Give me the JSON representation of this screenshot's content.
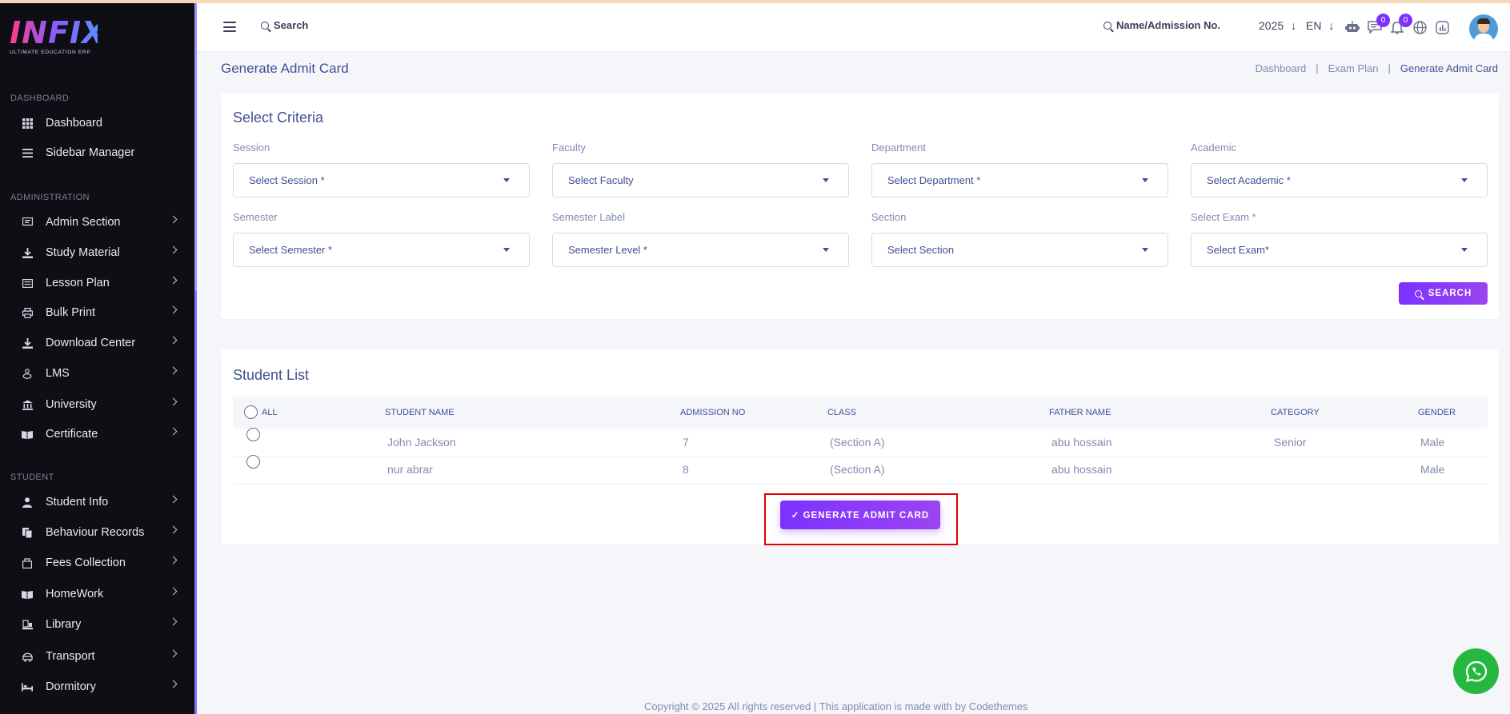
{
  "brand": {
    "logo": "INFIX",
    "tagline": "ULTIMATE EDUCATION ERP"
  },
  "sidebar": {
    "sections": [
      {
        "label": "DASHBOARD",
        "items": [
          {
            "label": "Dashboard",
            "icon": "grid-icon",
            "chevron": false
          },
          {
            "label": "Sidebar Manager",
            "icon": "menu-icon",
            "chevron": false
          }
        ]
      },
      {
        "label": "ADMINISTRATION",
        "items": [
          {
            "label": "Admin Section",
            "icon": "admin-icon",
            "chevron": true
          },
          {
            "label": "Study Material",
            "icon": "download-icon",
            "chevron": true
          },
          {
            "label": "Lesson Plan",
            "icon": "list-icon",
            "chevron": true
          },
          {
            "label": "Bulk Print",
            "icon": "printer-icon",
            "chevron": true
          },
          {
            "label": "Download Center",
            "icon": "download-icon",
            "chevron": true
          },
          {
            "label": "LMS",
            "icon": "lms-icon",
            "chevron": true
          },
          {
            "label": "University",
            "icon": "university-icon",
            "chevron": true
          },
          {
            "label": "Certificate",
            "icon": "book-icon",
            "chevron": true
          }
        ]
      },
      {
        "label": "STUDENT",
        "items": [
          {
            "label": "Student Info",
            "icon": "user-icon",
            "chevron": true
          },
          {
            "label": "Behaviour Records",
            "icon": "records-icon",
            "chevron": true
          },
          {
            "label": "Fees Collection",
            "icon": "fees-icon",
            "chevron": true
          },
          {
            "label": "HomeWork",
            "icon": "book-icon",
            "chevron": true
          },
          {
            "label": "Library",
            "icon": "library-icon",
            "chevron": true
          },
          {
            "label": "Transport",
            "icon": "transport-icon",
            "chevron": true
          },
          {
            "label": "Dormitory",
            "icon": "bed-icon",
            "chevron": true
          }
        ]
      }
    ]
  },
  "topbar": {
    "search": "Search",
    "name_search": "Name/Admission No.",
    "year": "2025",
    "lang": "EN",
    "chat_badge": "0",
    "notif_badge": "0"
  },
  "page": {
    "title": "Generate Admit Card",
    "breadcrumb": [
      "Dashboard",
      "Exam Plan",
      "Generate Admit Card"
    ]
  },
  "criteria": {
    "title": "Select Criteria",
    "fields": [
      {
        "label": "Session",
        "placeholder": "Select Session *"
      },
      {
        "label": "Faculty",
        "placeholder": "Select Faculty"
      },
      {
        "label": "Department",
        "placeholder": "Select Department *"
      },
      {
        "label": "Academic",
        "placeholder": "Select Academic *"
      },
      {
        "label": "Semester",
        "placeholder": "Select Semester *"
      },
      {
        "label": "Semester Label",
        "placeholder": "Semester Level *"
      },
      {
        "label": "Section",
        "placeholder": "Select Section"
      },
      {
        "label": "Select Exam *",
        "placeholder": "Select Exam*"
      }
    ],
    "search_button": "SEARCH"
  },
  "students": {
    "title": "Student List",
    "columns": [
      "ALL",
      "STUDENT NAME",
      "ADMISSION NO",
      "CLASS",
      "FATHER NAME",
      "CATEGORY",
      "GENDER"
    ],
    "rows": [
      {
        "name": "John Jackson",
        "admission": "7",
        "class": "(Section A)",
        "father": "abu hossain",
        "category": "Senior",
        "gender": "Male"
      },
      {
        "name": "nur abrar",
        "admission": "8",
        "class": "(Section A)",
        "father": "abu hossain",
        "category": "",
        "gender": "Male"
      }
    ],
    "generate_button": "✓ GENERATE ADMIT CARD"
  },
  "footer": "Copyright © 2025 All rights reserved | This application is made with by Codethemes",
  "colors": {
    "accent": "#7c32ff",
    "sidebar_bg": "#0e0e14",
    "text": "#415094",
    "highlight_box": "#e00000"
  }
}
